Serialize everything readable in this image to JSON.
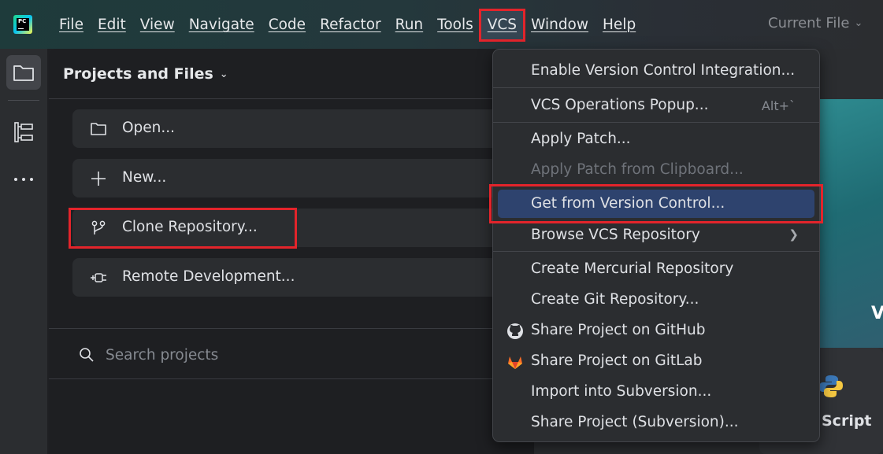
{
  "app": {
    "logo_text": "PC"
  },
  "menubar": {
    "items": [
      {
        "name": "file",
        "label": "File"
      },
      {
        "name": "edit",
        "label": "Edit"
      },
      {
        "name": "view",
        "label": "View"
      },
      {
        "name": "navigate",
        "label": "Navigate"
      },
      {
        "name": "code",
        "label": "Code"
      },
      {
        "name": "refactor",
        "label": "Refactor"
      },
      {
        "name": "run",
        "label": "Run"
      },
      {
        "name": "tools",
        "label": "Tools"
      },
      {
        "name": "vcs",
        "label": "VCS"
      },
      {
        "name": "window",
        "label": "Window"
      },
      {
        "name": "help",
        "label": "Help"
      }
    ],
    "active": "VCS"
  },
  "run_config": {
    "label": "Current File"
  },
  "rail": {
    "icons": [
      "folder-icon",
      "structure-icon",
      "more-icon"
    ]
  },
  "panel": {
    "title": "Projects and Files",
    "actions": [
      {
        "label": "Open...",
        "icon": "folder-icon"
      },
      {
        "label": "New...",
        "icon": "plus-icon"
      },
      {
        "label": "Clone Repository...",
        "icon": "branch-icon"
      },
      {
        "label": "Remote Development...",
        "icon": "plug-icon"
      }
    ],
    "search": {
      "placeholder": "Search projects"
    }
  },
  "vcs_menu": {
    "items": [
      {
        "label": "Enable Version Control Integration...",
        "state": "normal"
      },
      {
        "label": "VCS Operations Popup...",
        "shortcut": "Alt+`",
        "state": "normal"
      },
      {
        "label": "Apply Patch...",
        "state": "normal"
      },
      {
        "label": "Apply Patch from Clipboard...",
        "state": "disabled"
      },
      {
        "label": "Get from Version Control...",
        "state": "highlighted"
      },
      {
        "label": "Browse VCS Repository",
        "submenu": true,
        "state": "normal"
      },
      {
        "label": "Create Mercurial Repository",
        "state": "normal"
      },
      {
        "label": "Create Git Repository...",
        "state": "normal"
      },
      {
        "label": "Share Project on GitHub",
        "icon": "github-icon",
        "state": "normal"
      },
      {
        "label": "Share Project on GitLab",
        "icon": "gitlab-icon",
        "state": "normal"
      },
      {
        "label": "Import into Subversion...",
        "state": "normal"
      },
      {
        "label": "Share Project (Subversion)...",
        "state": "normal"
      }
    ]
  },
  "background": {
    "partial_letter": "V",
    "card_label": "v Script"
  },
  "colors": {
    "highlight": "#2e436e",
    "annotation": "#e3242b",
    "accent": "#3574f0"
  }
}
